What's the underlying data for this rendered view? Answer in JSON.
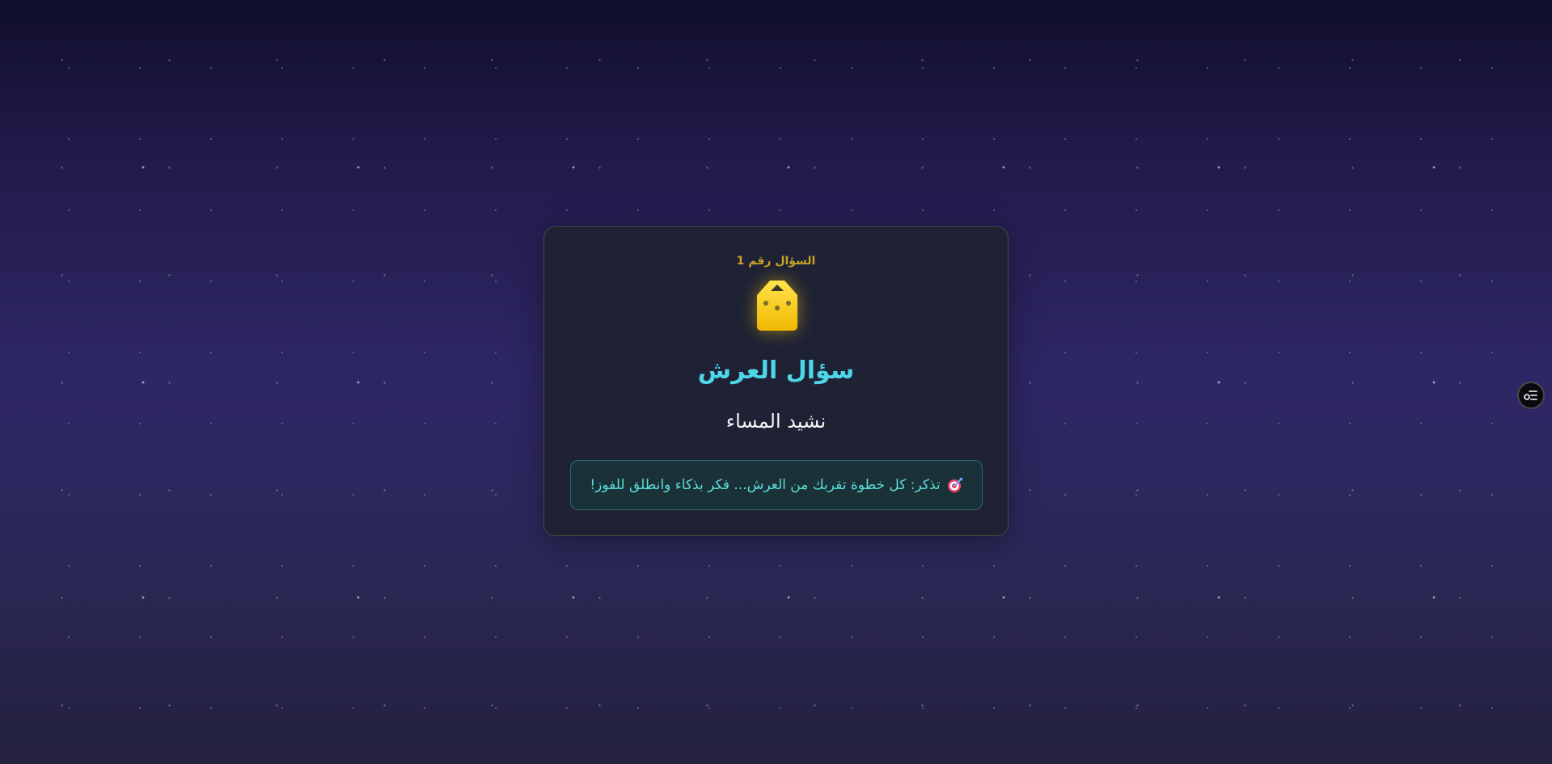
{
  "question": {
    "number_label": "السؤال رقم 1",
    "icon": "lock-icon",
    "title": "سؤال العرش",
    "subtitle": "نشيد المساء"
  },
  "hint": {
    "icon": "target-icon",
    "text": "تذكر: كل خطوة تقربك من العرش... فكر بذكاء وانطلق للفوز!"
  },
  "side_button": {
    "icon": "settings-list-icon"
  },
  "colors": {
    "accent_gold": "#c9a227",
    "title_cyan": "#4dd6e8",
    "hint_text": "#59dfd8",
    "card_bg": "#1e2234",
    "lock_yellow": "#f5c800"
  }
}
